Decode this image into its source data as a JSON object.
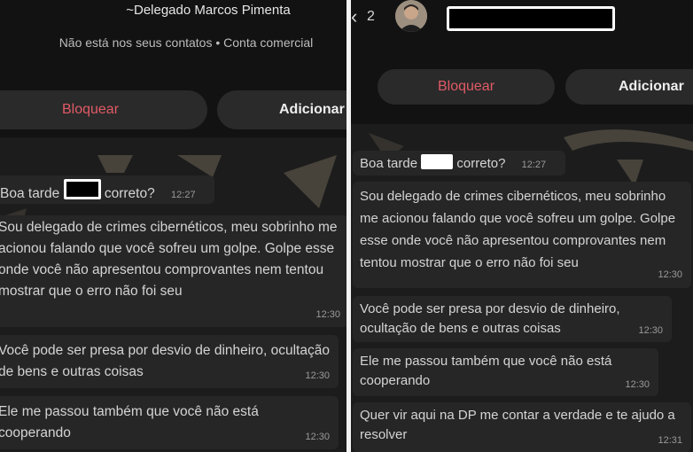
{
  "left": {
    "contact_name": "~Delegado Marcos Pimenta",
    "contact_subtitle": "Não está nos seus contatos • Conta comercial",
    "block_label": "Bloquear",
    "add_label": "Adicionar",
    "messages": [
      {
        "pre": "Boa tarde",
        "post": "correto?",
        "time": "12:27"
      },
      {
        "text": "Sou delegado de crimes cibernéticos, meu sobrinho me acionou falando que você sofreu um golpe. Golpe esse onde você não apresentou comprovantes nem tentou mostrar que o erro não foi seu",
        "time": "12:30"
      },
      {
        "text": "Você pode ser presa por desvio de dinheiro, ocultação de bens e outras coisas",
        "time": "12:30"
      },
      {
        "text": "Ele me passou também que você não está cooperando",
        "time": "12:30"
      }
    ]
  },
  "right": {
    "back_icon": "chevron-left-icon",
    "unread_count": "2",
    "block_label": "Bloquear",
    "add_label": "Adicionar",
    "messages": [
      {
        "pre": "Boa tarde",
        "post": "correto?",
        "time": "12:27"
      },
      {
        "text": "Sou delegado de crimes cibernéticos, meu sobrinho me acionou falando que você sofreu um golpe. Golpe esse onde você não apresentou comprovantes nem tentou mostrar que o erro não foi seu",
        "time": "12:30"
      },
      {
        "text": "Você pode ser presa por desvio de dinheiro, ocultação de bens e outras coisas",
        "time": "12:30"
      },
      {
        "text": "Ele me passou também que você não está cooperando",
        "time": "12:30"
      },
      {
        "text": "Quer vir aqui na DP me contar a verdade e te ajudo a resolver",
        "time": "12:31"
      }
    ]
  }
}
